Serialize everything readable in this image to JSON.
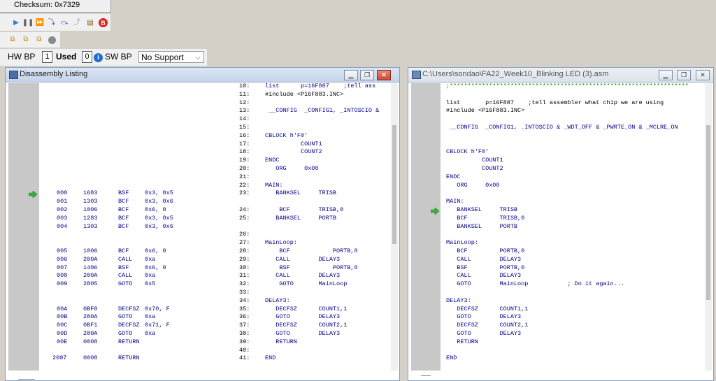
{
  "toolbar": {
    "checksum_label": "Checksum:  0x7329",
    "hw_bp_label": "HW BP",
    "used_count": "1",
    "used_label": "Used",
    "info_count": "0",
    "sw_bp_label": "SW BP",
    "sw_bp_select": "No Support"
  },
  "disasm": {
    "title": "Disassembly Listing",
    "rows": [
      {
        "addr": "",
        "op": "",
        "inst": "",
        "args": "",
        "ln": "10:",
        "src": "list      p=16F887    ;tell ass"
      },
      {
        "addr": "",
        "op": "",
        "inst": "",
        "args": "",
        "ln": "11:",
        "src": "#include <P16F883.INC>"
      },
      {
        "addr": "",
        "op": "",
        "inst": "",
        "args": "",
        "ln": "12:",
        "src": ""
      },
      {
        "addr": "",
        "op": "",
        "inst": "",
        "args": "",
        "ln": "13:",
        "src": " __CONFIG  _CONFIG1, _INTOSCIO &"
      },
      {
        "addr": "",
        "op": "",
        "inst": "",
        "args": "",
        "ln": "14:",
        "src": ""
      },
      {
        "addr": "",
        "op": "",
        "inst": "",
        "args": "",
        "ln": "15:",
        "src": ""
      },
      {
        "addr": "",
        "op": "",
        "inst": "",
        "args": "",
        "ln": "16:",
        "src": "CBLOCK h'F0'"
      },
      {
        "addr": "",
        "op": "",
        "inst": "",
        "args": "",
        "ln": "17:",
        "src": "          COUNT1"
      },
      {
        "addr": "",
        "op": "",
        "inst": "",
        "args": "",
        "ln": "18:",
        "src": "          COUNT2"
      },
      {
        "addr": "",
        "op": "",
        "inst": "",
        "args": "",
        "ln": "19:",
        "src": "ENDC"
      },
      {
        "addr": "",
        "op": "",
        "inst": "",
        "args": "",
        "ln": "20:",
        "src": "   ORG     0x00"
      },
      {
        "addr": "",
        "op": "",
        "inst": "",
        "args": "",
        "ln": "21:",
        "src": ""
      },
      {
        "addr": "",
        "op": "",
        "inst": "",
        "args": "",
        "ln": "22:",
        "src": "MAIN:"
      },
      {
        "addr": "000",
        "op": "1683",
        "inst": "BSF",
        "args": "0x3, 0x5",
        "ln": "23:",
        "src": "   BANKSEL     TRISB"
      },
      {
        "addr": "001",
        "op": "1303",
        "inst": "BCF",
        "args": "0x3, 0x6",
        "ln": "",
        "src": ""
      },
      {
        "addr": "002",
        "op": "1006",
        "inst": "BCF",
        "args": "0x6, 0",
        "ln": "24:",
        "src": "    BCF        TRISB,0"
      },
      {
        "addr": "003",
        "op": "1283",
        "inst": "BCF",
        "args": "0x3, 0x5",
        "ln": "25:",
        "src": "   BANKSEL     PORTB"
      },
      {
        "addr": "004",
        "op": "1303",
        "inst": "BCF",
        "args": "0x3, 0x6",
        "ln": "",
        "src": ""
      },
      {
        "addr": "",
        "op": "",
        "inst": "",
        "args": "",
        "ln": "26:",
        "src": ""
      },
      {
        "addr": "",
        "op": "",
        "inst": "",
        "args": "",
        "ln": "27:",
        "src": "MainLoop:"
      },
      {
        "addr": "005",
        "op": "1006",
        "inst": "BCF",
        "args": "0x6, 0",
        "ln": "28:",
        "src": "    BCF            PORTB,0"
      },
      {
        "addr": "006",
        "op": "200A",
        "inst": "CALL",
        "args": "0xa",
        "ln": "29:",
        "src": "   CALL        DELAY3"
      },
      {
        "addr": "007",
        "op": "1406",
        "inst": "BSF",
        "args": "0x6, 0",
        "ln": "30:",
        "src": "    BSF            PORTB,0"
      },
      {
        "addr": "008",
        "op": "200A",
        "inst": "CALL",
        "args": "0xa",
        "ln": "31:",
        "src": "   CALL        DELAY3"
      },
      {
        "addr": "009",
        "op": "2805",
        "inst": "GOTO",
        "args": "0x5",
        "ln": "32:",
        "src": "    GOTO       MainLoop"
      },
      {
        "addr": "",
        "op": "",
        "inst": "",
        "args": "",
        "ln": "33:",
        "src": ""
      },
      {
        "addr": "",
        "op": "",
        "inst": "",
        "args": "",
        "ln": "34:",
        "src": "DELAY3:"
      },
      {
        "addr": "00A",
        "op": "0BF0",
        "inst": "DECFSZ",
        "args": "0x70, F",
        "ln": "35:",
        "src": "   DECFSZ      COUNT1,1"
      },
      {
        "addr": "00B",
        "op": "280A",
        "inst": "GOTO",
        "args": "0xa",
        "ln": "36:",
        "src": "   GOTO        DELAY3"
      },
      {
        "addr": "00C",
        "op": "0BF1",
        "inst": "DECFSZ",
        "args": "0x71, F",
        "ln": "37:",
        "src": "   DECFSZ      COUNT2,1"
      },
      {
        "addr": "00D",
        "op": "280A",
        "inst": "GOTO",
        "args": "0xa",
        "ln": "38:",
        "src": "   GOTO        DELAY3"
      },
      {
        "addr": "00E",
        "op": "0008",
        "inst": "RETURN",
        "args": "",
        "ln": "39:",
        "src": "   RETURN"
      },
      {
        "addr": "",
        "op": "",
        "inst": "",
        "args": "",
        "ln": "40:",
        "src": ""
      },
      {
        "addr": "2007",
        "op": "0008",
        "inst": "RETURN",
        "args": "",
        "ln": "41:",
        "src": "END"
      }
    ]
  },
  "source": {
    "title": "C:\\Users\\sondao\\FA22_Week10_Blinking LED (3).asm",
    "lines": [
      ";*******************************************************************",
      "",
      "list       p=16F887    ;tell assembler what chip we are using",
      "#include <P16F883.INC>",
      "",
      " __CONFIG  _CONFIG1, _INTOSCIO & _WDT_OFF & _PWRTE_ON & _MCLRE_ON",
      "",
      "",
      "CBLOCK h'F0'",
      "          COUNT1",
      "          COUNT2",
      "ENDC",
      "   ORG     0x00",
      "",
      "MAIN:",
      "   BANKSEL     TRISB",
      "   BCF         TRISB,0",
      "   BANKSEL     PORTB",
      "",
      "MainLoop:",
      "   BCF         PORTB,0",
      "   CALL        DELAY3",
      "   BSF         PORTB,0",
      "   CALL        DELAY3",
      "   GOTO        MainLoop           ; Do it again...",
      "",
      "DELAY3:",
      "   DECFSZ      COUNT1,1",
      "   GOTO        DELAY3",
      "   DECFSZ      COUNT2,1",
      "   GOTO        DELAY3",
      "   RETURN",
      "",
      "END"
    ]
  },
  "colors": {
    "keyword": "#00008b",
    "comment": "#008000",
    "arrow": "#2eb82e",
    "close": "#c84a36"
  },
  "icons": [
    "run-icon",
    "pause-icon",
    "animate-icon",
    "step-into-icon",
    "step-over-icon",
    "step-out-icon",
    "reset-icon",
    "breakpoint-icon",
    "info-icon"
  ]
}
